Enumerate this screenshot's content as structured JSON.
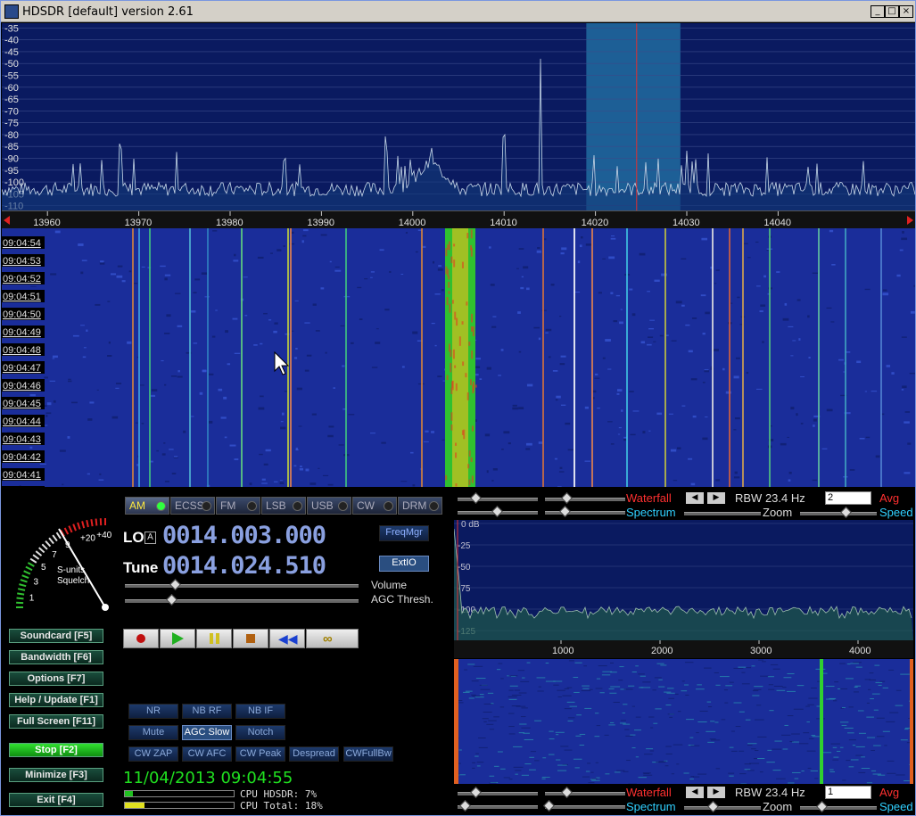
{
  "window": {
    "title": "HDSDR [default]  version 2.61",
    "minimize": "_",
    "maximize": "□",
    "close": "×"
  },
  "spectrum": {
    "db_labels": [
      "-35",
      "-40",
      "-45",
      "-50",
      "-55",
      "-60",
      "-65",
      "-70",
      "-75",
      "-80",
      "-85",
      "-90",
      "-95",
      "-100",
      "-105",
      "-110"
    ],
    "freq_labels": [
      "13960",
      "13970",
      "13980",
      "13990",
      "14000",
      "14010",
      "14020",
      "14030",
      "14040"
    ],
    "chart_data": {
      "type": "line",
      "x_range_khz": [
        13955,
        14055
      ],
      "y_range_db": [
        -112,
        -33
      ],
      "peaks_khz": [
        13968,
        13997,
        14002,
        14010,
        14014,
        14030
      ],
      "passband_khz": [
        14019,
        14029.3
      ],
      "tune_khz": [
        14024.51
      ]
    }
  },
  "waterfall": {
    "times": [
      "09:04:54",
      "09:04:53",
      "09:04:52",
      "09:04:51",
      "09:04:50",
      "09:04:49",
      "09:04:48",
      "09:04:47",
      "09:04:46",
      "09:04:45",
      "09:04:44",
      "09:04:43",
      "09:04:42",
      "09:04:41",
      "09:04:40"
    ]
  },
  "smeter": {
    "scale_labels": [
      "1",
      "3",
      "5",
      "7",
      "9",
      "+20",
      "+40"
    ],
    "label1": "S-units",
    "label2": "Squelch"
  },
  "modes": [
    "AM",
    "ECSS",
    "FM",
    "LSB",
    "USB",
    "CW",
    "DRM"
  ],
  "active_mode": "AM",
  "lo": {
    "label": "LO",
    "badge": "A",
    "value": "0014.003.000"
  },
  "tune": {
    "label": "Tune",
    "value": "0014.024.510"
  },
  "buttons": {
    "freqmgr": "FreqMgr",
    "extio": "ExtIO",
    "volume": "Volume",
    "agc_thresh": "AGC Thresh."
  },
  "side_buttons": [
    "Soundcard  [F5]",
    "Bandwidth  [F6]",
    "Options     [F7]",
    "Help / Update  [F1]",
    "Full Screen  [F11]",
    "Stop          [F2]",
    "Minimize  [F3]",
    "Exit          [F4]"
  ],
  "dsp_buttons": [
    "NR",
    "NB RF",
    "NB IF",
    "Mute",
    "AGC Slow",
    "Notch",
    "CW ZAP",
    "CW AFC",
    "CW Peak",
    "Despread",
    "CWFullBw"
  ],
  "datetime": "11/04/2013 09:04:55",
  "cpu": {
    "hdsdr": "CPU HDSDR:  7%",
    "total": "CPU Total:  18%",
    "hdsdr_level": 0.07,
    "total_level": 0.18
  },
  "audio": {
    "top_bar": {
      "waterfall": "Waterfall",
      "rbw": "RBW 23.4 Hz",
      "avg_value": "2",
      "avg": "Avg",
      "spectrum": "Spectrum",
      "zoom": "Zoom",
      "speed": "Speed"
    },
    "bottom_bar": {
      "waterfall": "Waterfall",
      "rbw": "RBW 23.4 Hz",
      "avg_value": "1",
      "avg": "Avg",
      "spectrum": "Spectrum",
      "zoom": "Zoom",
      "speed": "Speed"
    },
    "db_labels": [
      "0 dB",
      "-25",
      "-50",
      "-75",
      "-100",
      "-125"
    ],
    "freq_labels": [
      "1000",
      "2000",
      "3000",
      "4000"
    ]
  },
  "colors": {
    "accent_red": "#ff2020",
    "waterfall_label": "#ff3030",
    "spectrum_label": "#30d0ff"
  }
}
